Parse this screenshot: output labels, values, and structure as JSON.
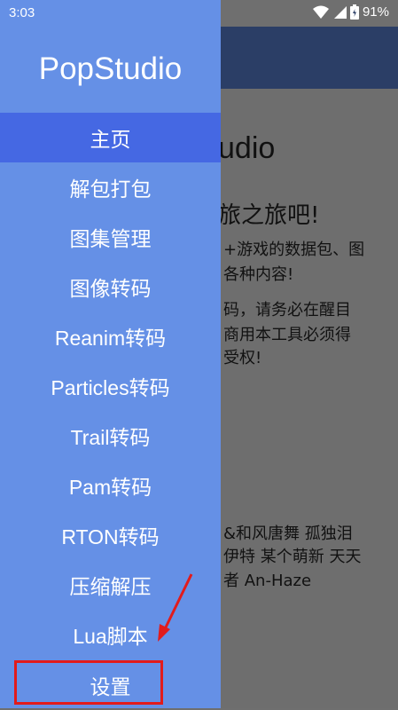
{
  "status": {
    "time": "3:03",
    "battery": "91%"
  },
  "background": {
    "title": "udio",
    "subtitle": "旅之旅吧!",
    "lines": [
      "+游戏的数据包、图",
      "各种内容!",
      "码，请务必在醒目",
      "商用本工具必须得",
      "受权!",
      "&和风唐舞 孤独泪",
      "伊特 某个萌新 天天",
      "者 An-Haze"
    ]
  },
  "drawer": {
    "title": "PopStudio",
    "items": [
      {
        "label": "主页",
        "active": true
      },
      {
        "label": "解包打包"
      },
      {
        "label": "图集管理"
      },
      {
        "label": "图像转码"
      },
      {
        "label": "Reanim转码"
      },
      {
        "label": "Particles转码"
      },
      {
        "label": "Trail转码"
      },
      {
        "label": "Pam转码"
      },
      {
        "label": "RTON转码"
      },
      {
        "label": "压缩解压"
      },
      {
        "label": "Lua脚本"
      },
      {
        "label": "设置"
      }
    ]
  },
  "colors": {
    "drawer": "#6590e6",
    "active": "#4568e3",
    "highlight": "#e21b1b"
  }
}
